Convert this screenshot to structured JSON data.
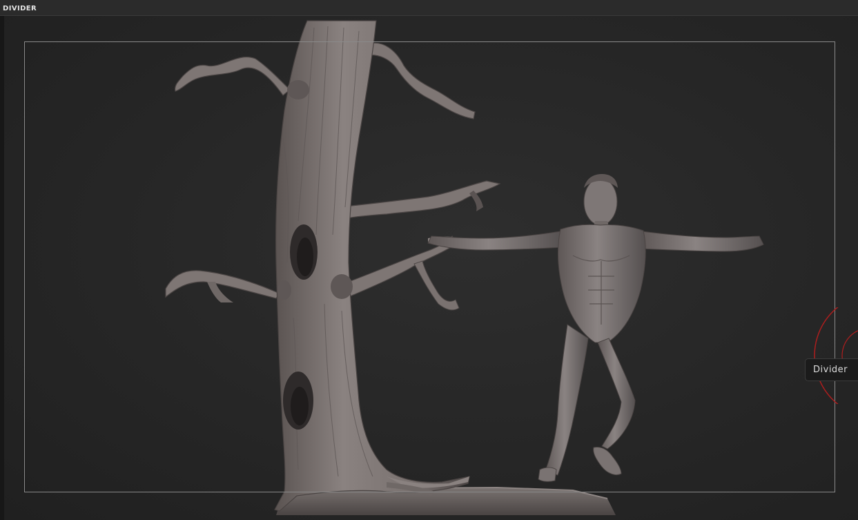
{
  "titlebar": {
    "title": "DIVIDER"
  },
  "tooltip": {
    "text": "Divider"
  },
  "viewport": {
    "background": "#262626",
    "frame_color": "#8a8a8a",
    "model_color": "#7d7573",
    "model_shadow": "#4a4443",
    "gizmo_color": "#b01e1e"
  },
  "scene": {
    "objects": [
      "dead-tree-sculpt",
      "male-figure-sculpt",
      "base-plinth"
    ]
  }
}
